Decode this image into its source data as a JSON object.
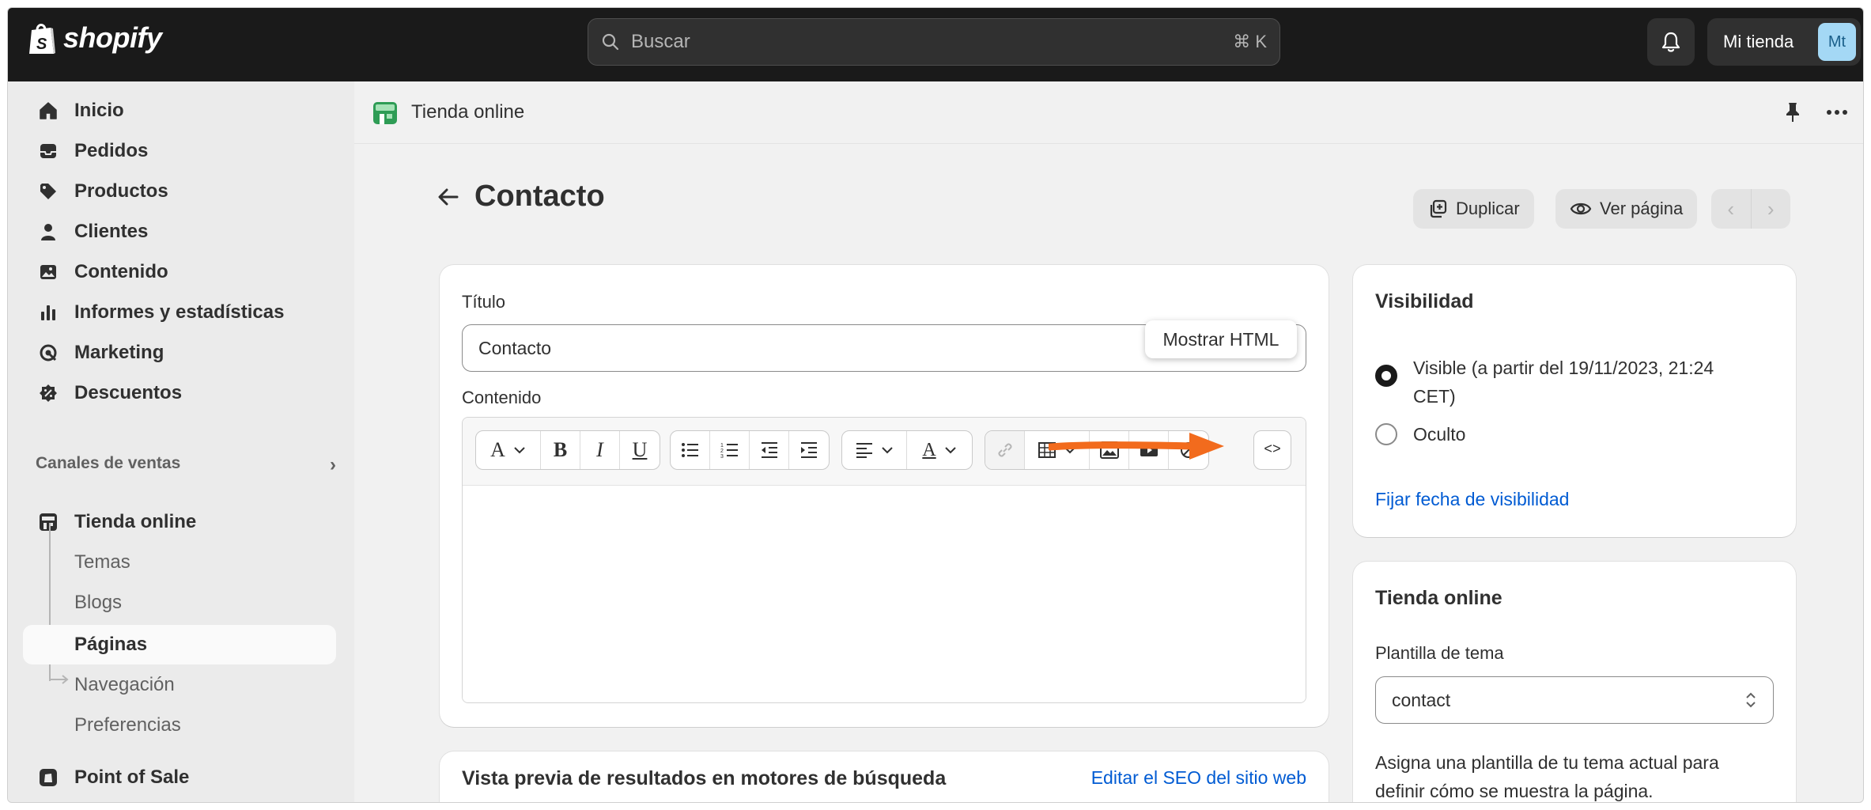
{
  "topbar": {
    "brand": "shopify",
    "search_placeholder": "Buscar",
    "search_shortcut": "⌘ K",
    "store_name": "Mi tienda",
    "avatar_initials": "Mt"
  },
  "sidebar": {
    "items": [
      {
        "label": "Inicio",
        "icon": "home-icon"
      },
      {
        "label": "Pedidos",
        "icon": "inbox-icon"
      },
      {
        "label": "Productos",
        "icon": "tag-icon"
      },
      {
        "label": "Clientes",
        "icon": "person-icon"
      },
      {
        "label": "Contenido",
        "icon": "image-icon"
      },
      {
        "label": "Informes y estadísticas",
        "icon": "bar-chart-icon"
      },
      {
        "label": "Marketing",
        "icon": "target-icon"
      },
      {
        "label": "Descuentos",
        "icon": "discount-icon"
      }
    ],
    "sales_channels_label": "Canales de ventas",
    "online_store": "Tienda online",
    "subitems": [
      "Temas",
      "Blogs",
      "Páginas",
      "Navegación",
      "Preferencias"
    ],
    "pos": "Point of Sale"
  },
  "appbar": {
    "title": "Tienda online"
  },
  "page": {
    "title": "Contacto",
    "duplicate_label": "Duplicar",
    "view_label": "Ver página",
    "prev": "‹",
    "next": "›"
  },
  "content_card": {
    "title_label": "Título",
    "title_value": "Contacto",
    "content_label": "Contenido",
    "tooltip": "Mostrar HTML",
    "html_button": "<>"
  },
  "seo_card": {
    "title": "Vista previa de resultados en motores de búsqueda",
    "edit_link": "Editar el SEO del sitio web"
  },
  "visibility_card": {
    "title": "Visibilidad",
    "visible_option_line1": "Visible (a partir del 19/11/2023, 21:24",
    "visible_option_line2": "CET)",
    "hidden_option": "Oculto",
    "selected": "visible",
    "set_date_link": "Fijar fecha de visibilidad"
  },
  "template_card": {
    "title": "Tienda online",
    "template_label": "Plantilla de tema",
    "template_value": "contact",
    "help_line1": "Asigna una plantilla de tu tema actual para",
    "help_line2": "definir cómo se muestra la página."
  },
  "colors": {
    "topbar_bg": "#1a1a1a",
    "link": "#005bd3",
    "annotation_arrow": "#f26b1d"
  }
}
